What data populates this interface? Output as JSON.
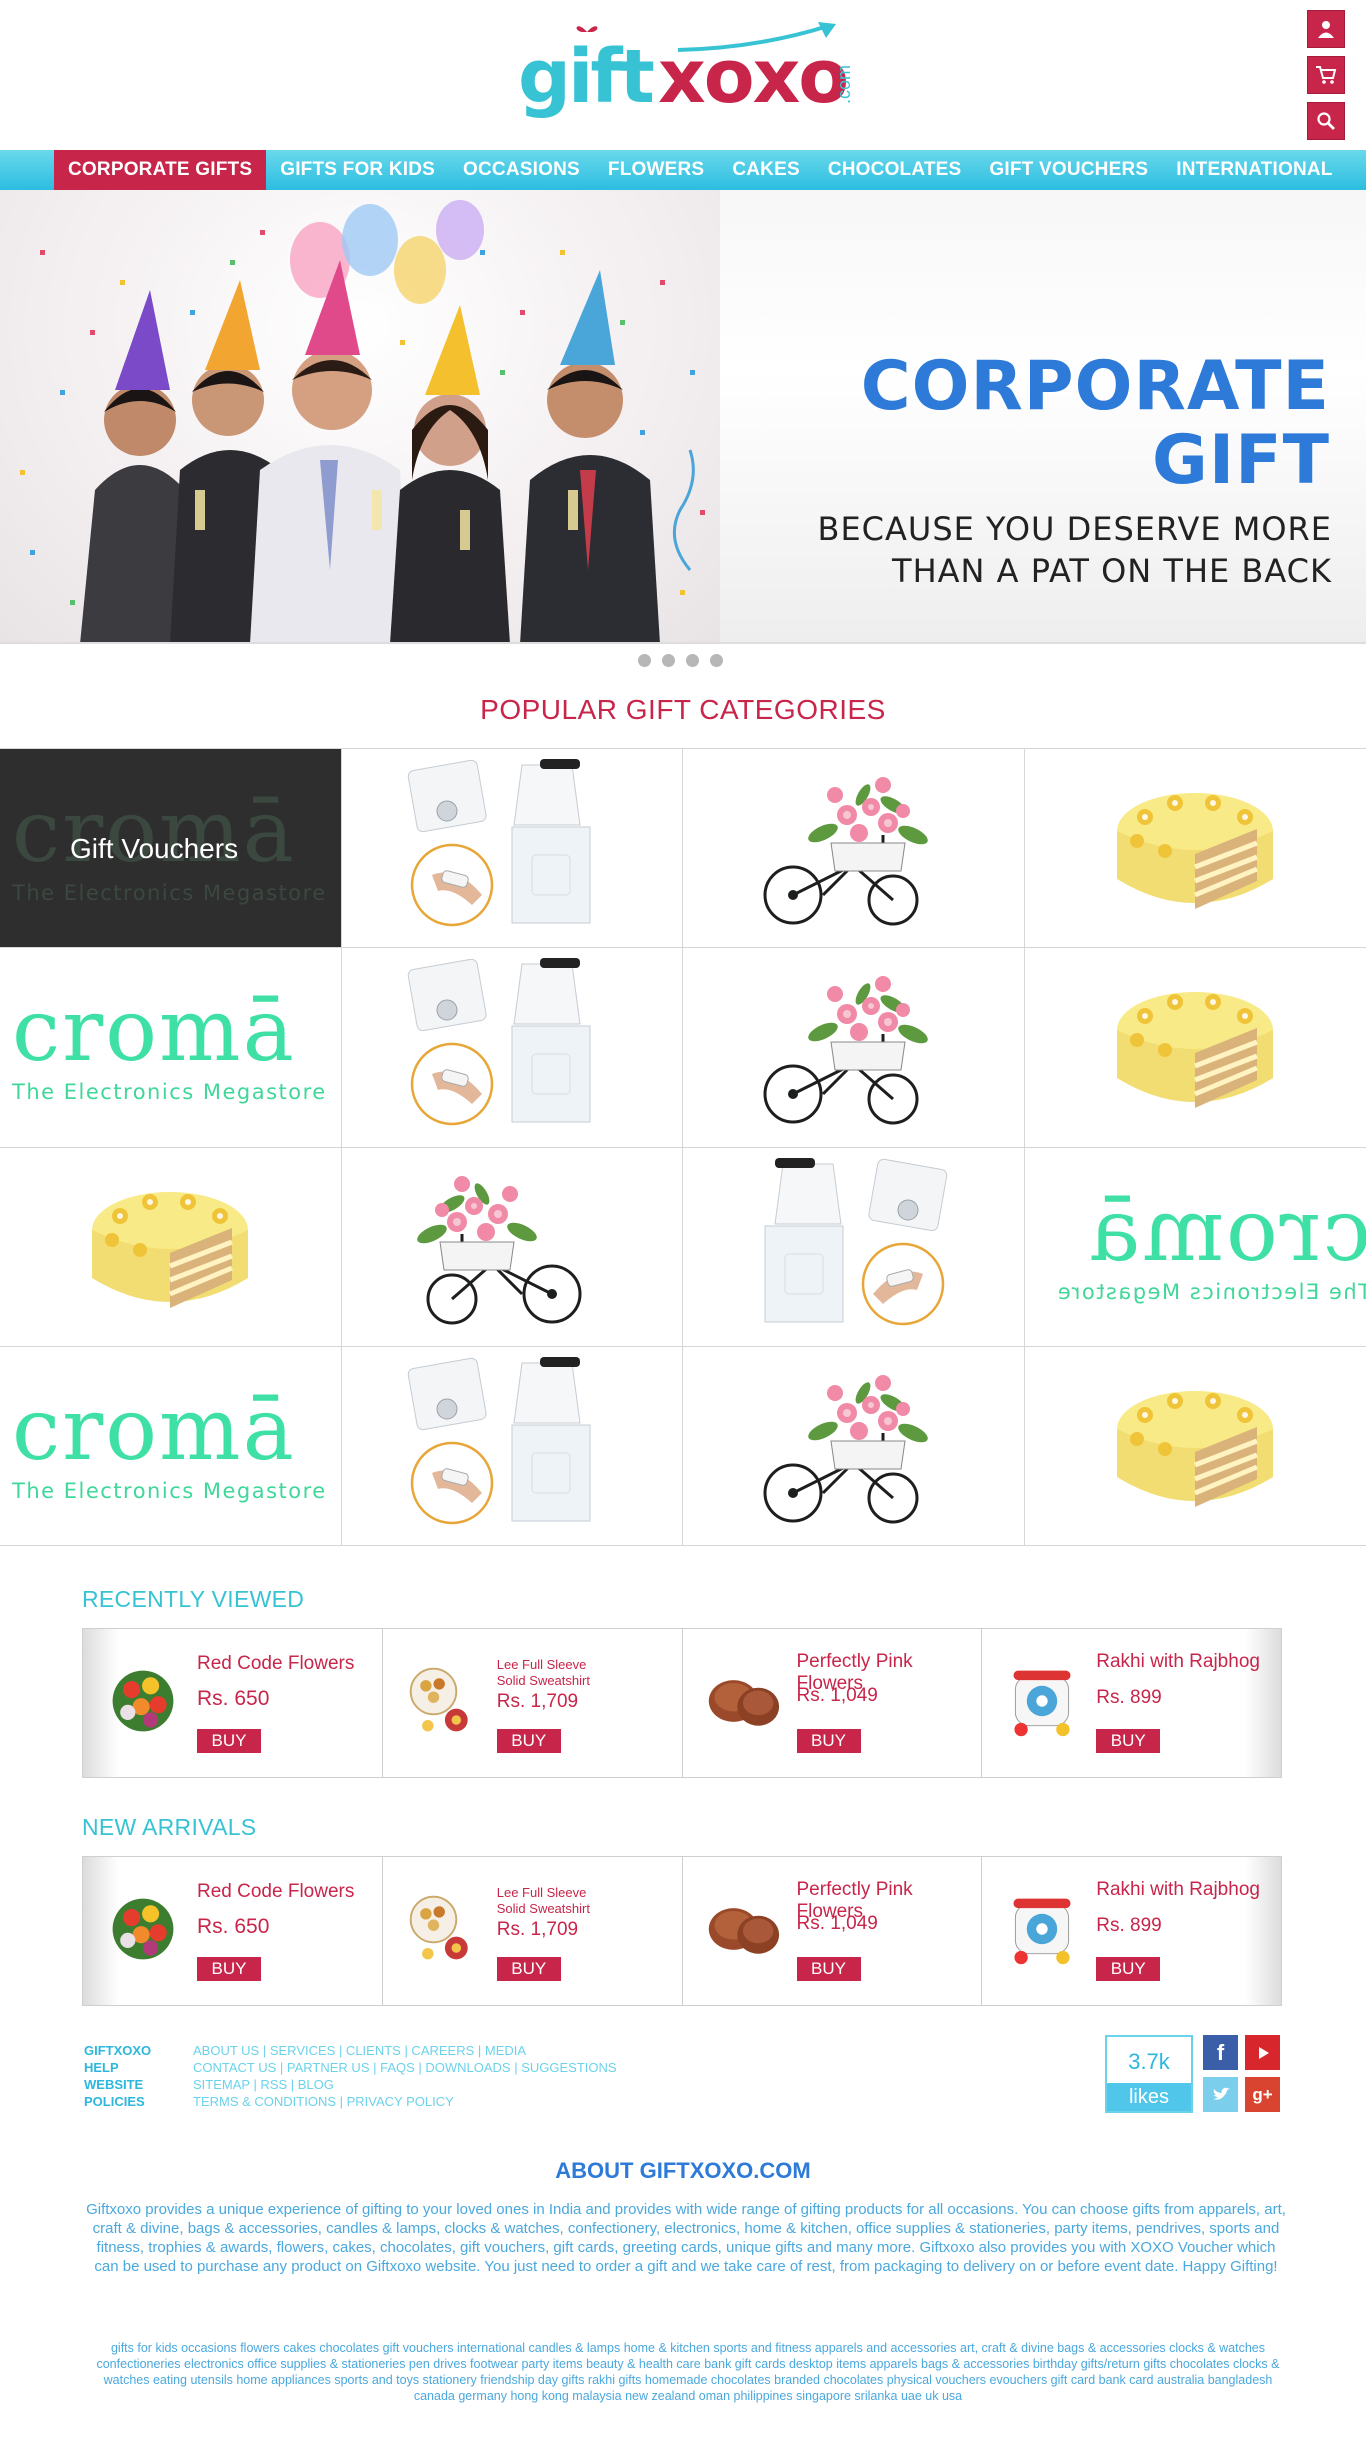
{
  "brand": {
    "logo_gift": "gift",
    "logo_xoxo": "xoxo",
    "logo_com": ".com"
  },
  "nav": {
    "items": [
      {
        "label": "CORPORATE GIFTS"
      },
      {
        "label": "GIFTS FOR KIDS"
      },
      {
        "label": "OCCASIONS"
      },
      {
        "label": "FLOWERS"
      },
      {
        "label": "CAKES"
      },
      {
        "label": "CHOCOLATES"
      },
      {
        "label": "GIFT VOUCHERS"
      },
      {
        "label": "INTERNATIONAL"
      }
    ]
  },
  "banner": {
    "title_line1": "CORPORATE",
    "title_line2": "GIFT",
    "subtitle_line1": "BECAUSE YOU DESERVE MORE",
    "subtitle_line2": "THAN A PAT ON THE BACK",
    "slide_count": 4
  },
  "popular": {
    "title": "POPULAR GIFT CATEGORIES",
    "croma_word": "cromā",
    "croma_tag": "The Electronics Megastore",
    "gift_vouchers_label": "Gift Vouchers"
  },
  "recently_viewed": {
    "title": "RECENTLY VIEWED",
    "products": [
      {
        "name": "Red Code Flowers",
        "price": "Rs. 650",
        "buy": "BUY"
      },
      {
        "name": "Lee Full Sleeve Solid Sweatshirt",
        "price": "Rs. 1,709",
        "buy": "BUY"
      },
      {
        "name": "Perfectly Pink Flowers",
        "price": "Rs. 1,049",
        "buy": "BUY"
      },
      {
        "name": "Rakhi with Rajbhog",
        "price": "Rs. 899",
        "buy": "BUY"
      }
    ]
  },
  "new_arrivals": {
    "title": "NEW ARRIVALS",
    "products": [
      {
        "name": "Red Code Flowers",
        "price": "Rs. 650",
        "buy": "BUY"
      },
      {
        "name": "Lee Full Sleeve Solid Sweatshirt",
        "price": "Rs. 1,709",
        "buy": "BUY"
      },
      {
        "name": "Perfectly Pink Flowers",
        "price": "Rs. 1,049",
        "buy": "BUY"
      },
      {
        "name": "Rakhi with Rajbhog",
        "price": "Rs. 899",
        "buy": "BUY"
      }
    ]
  },
  "footer": {
    "rows": [
      {
        "key": "GIFTXOXO",
        "links": "ABOUT US | SERVICES | CLIENTS | CAREERS | MEDIA"
      },
      {
        "key": "HELP",
        "links": "CONTACT US | PARTNER US | FAQS | DOWNLOADS | SUGGESTIONS"
      },
      {
        "key": "WEBSITE",
        "links": "SITEMAP | RSS | BLOG"
      },
      {
        "key": "POLICIES",
        "links": "TERMS & CONDITIONS | PRIVACY POLICY"
      }
    ],
    "likes_count": "3.7k",
    "likes_label": "likes"
  },
  "about": {
    "title": "ABOUT GIFTXOXO.COM",
    "text": "Giftxoxo provides a unique experience of gifting to your loved ones in India and provides with wide range of gifting products for all occasions. You can choose gifts from apparels, art, craft & divine, bags & accessories, candles & lamps, clocks & watches, confectionery, electronics, home & kitchen, office supplies & stationeries, party items, pendrives, sports and fitness, trophies & awards, flowers, cakes, chocolates, gift vouchers, gift cards, greeting cards, unique gifts and many more. Giftxoxo also provides you with XOXO Voucher which can be used to purchase any product on Giftxoxo website. You just need to order a gift and we take care of rest, from packaging to delivery on or before event date. Happy Gifting!",
    "tags": "gifts for kids occasions flowers  cakes chocolates gift vouchers international candles & lamps home & kitchen sports and fitness apparels and accessories art, craft & divine bags & accessories clocks & watches confectioneries electronics office supplies & stationeries pen drives footwear party items beauty & health care bank gift cards desktop items apparels bags & accessories birthday gifts/return gifts chocolates clocks & watches eating utensils home appliances sports and toys stationery friendship day gifts rakhi gifts homemade chocolates branded chocolates physical vouchers evouchers gift card bank card australia bangladesh canada germany hong kong malaysia new zealand oman philippines singapore srilanka uae uk usa"
  },
  "colors": {
    "brand_red": "#c8254a",
    "brand_cyan": "#37c3d4",
    "banner_blue": "#2d7ad8"
  }
}
